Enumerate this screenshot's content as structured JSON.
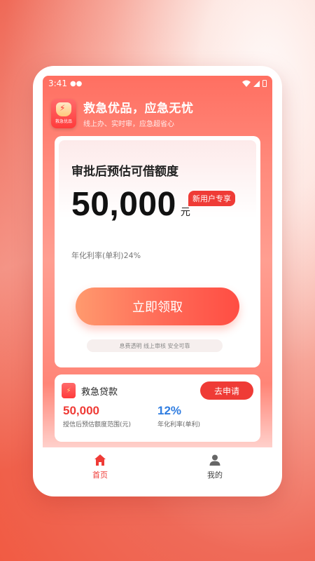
{
  "status_bar": {
    "time": "3:41"
  },
  "header": {
    "logo_text": "救急优品",
    "slogan": "救急优品，应急无忧",
    "sub_slogan": "线上办、实时审，应急超省心"
  },
  "main_card": {
    "title": "审批后预估可借额度",
    "amount": "50,000",
    "unit": "元",
    "badge": "新用户专享",
    "rate_text": "年化利率(单利)24%",
    "claim_label": "立即领取",
    "trust_text": "息费透明 线上审核 安全可靠"
  },
  "loan_card": {
    "name": "救急贷款",
    "apply_label": "去申请",
    "stat1_value": "50,000",
    "stat1_label": "授信后预估额度范围(元)",
    "stat2_value": "12%",
    "stat2_label": "年化利率(单利)"
  },
  "bottom_nav": {
    "items": [
      {
        "label": "首页",
        "icon": "home-icon"
      },
      {
        "label": "我的",
        "icon": "user-icon"
      }
    ]
  },
  "colors": {
    "accent": "#ef3b36",
    "blue": "#2f7de1"
  }
}
